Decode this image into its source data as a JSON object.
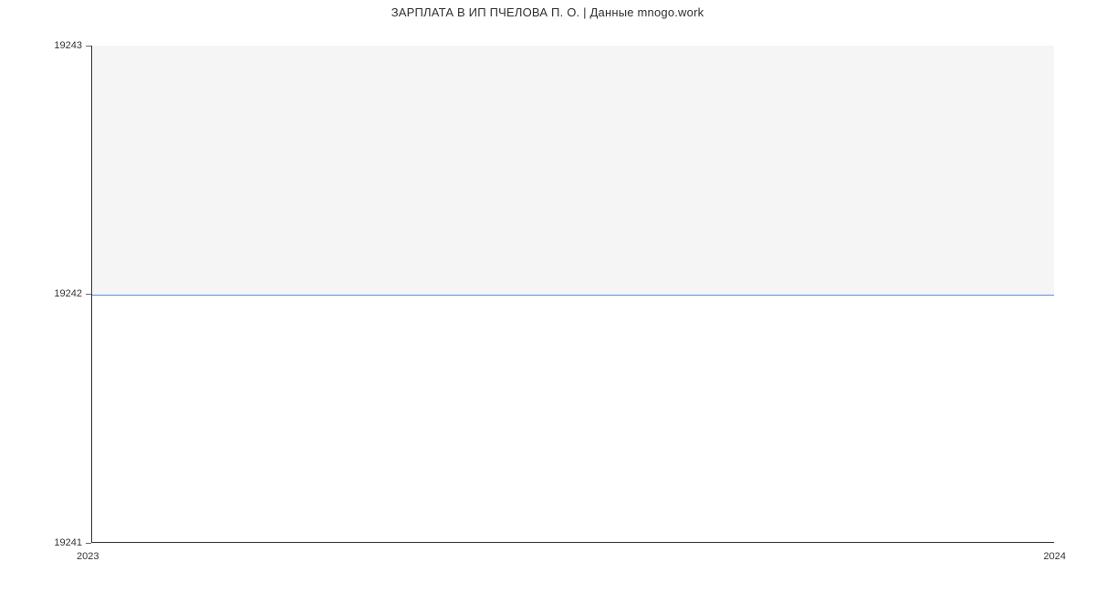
{
  "title": "ЗАРПЛАТА В ИП ПЧЕЛОВА П. О. | Данные mnogo.work",
  "y_ticks": {
    "top": "19243",
    "mid": "19242",
    "bot": "19241"
  },
  "x_ticks": {
    "left": "2023",
    "right": "2024"
  },
  "chart_data": {
    "type": "line",
    "title": "ЗАРПЛАТА В ИП ПЧЕЛОВА П. О. | Данные mnogo.work",
    "xlabel": "",
    "ylabel": "",
    "x": [
      2023,
      2024
    ],
    "y": [
      19242,
      19242
    ],
    "ylim": [
      19241,
      19243
    ],
    "xlim": [
      2023,
      2024
    ],
    "series": [
      {
        "name": "Зарплата",
        "x": [
          2023,
          2024
        ],
        "y": [
          19242,
          19242
        ],
        "color": "#5b8fd6"
      }
    ],
    "grid": false,
    "legend": false
  }
}
